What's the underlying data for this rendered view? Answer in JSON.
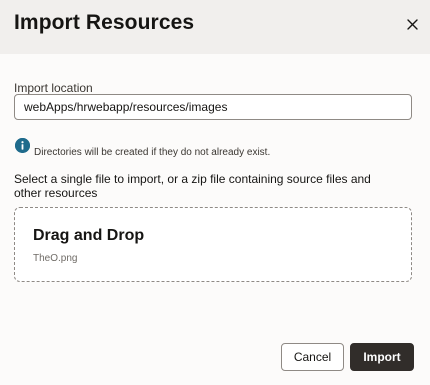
{
  "dialog": {
    "title": "Import Resources",
    "close_icon": "close-icon"
  },
  "location": {
    "label": "Import location",
    "value": "webApps/hrwebapp/resources/images"
  },
  "info": {
    "icon": "info-icon",
    "text": "Directories will be created if they do not already exist."
  },
  "instructions": "Select a single file to import, or a zip file containing source files and other resources",
  "dropzone": {
    "title": "Drag and Drop",
    "file_name": "TheO.png"
  },
  "buttons": {
    "cancel": "Cancel",
    "import": "Import"
  },
  "colors": {
    "header_bg": "#f1efed",
    "primary_button": "#312d2a",
    "info_icon": "#1f6b8c"
  }
}
